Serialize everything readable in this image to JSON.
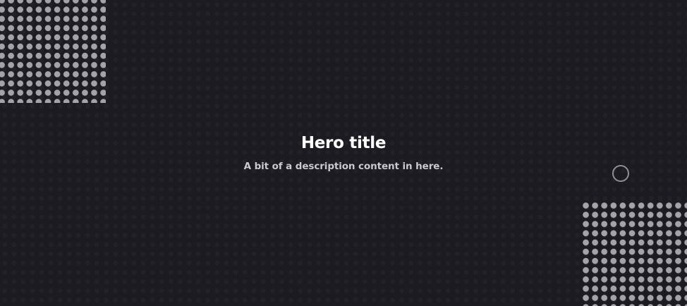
{
  "hero": {
    "title": "Hero title",
    "description": "A bit of a description content in here."
  },
  "decor": {
    "dot_color": "#a3a3a8",
    "background_color": "#1c1b21",
    "ring_color": "#8f8f94"
  }
}
